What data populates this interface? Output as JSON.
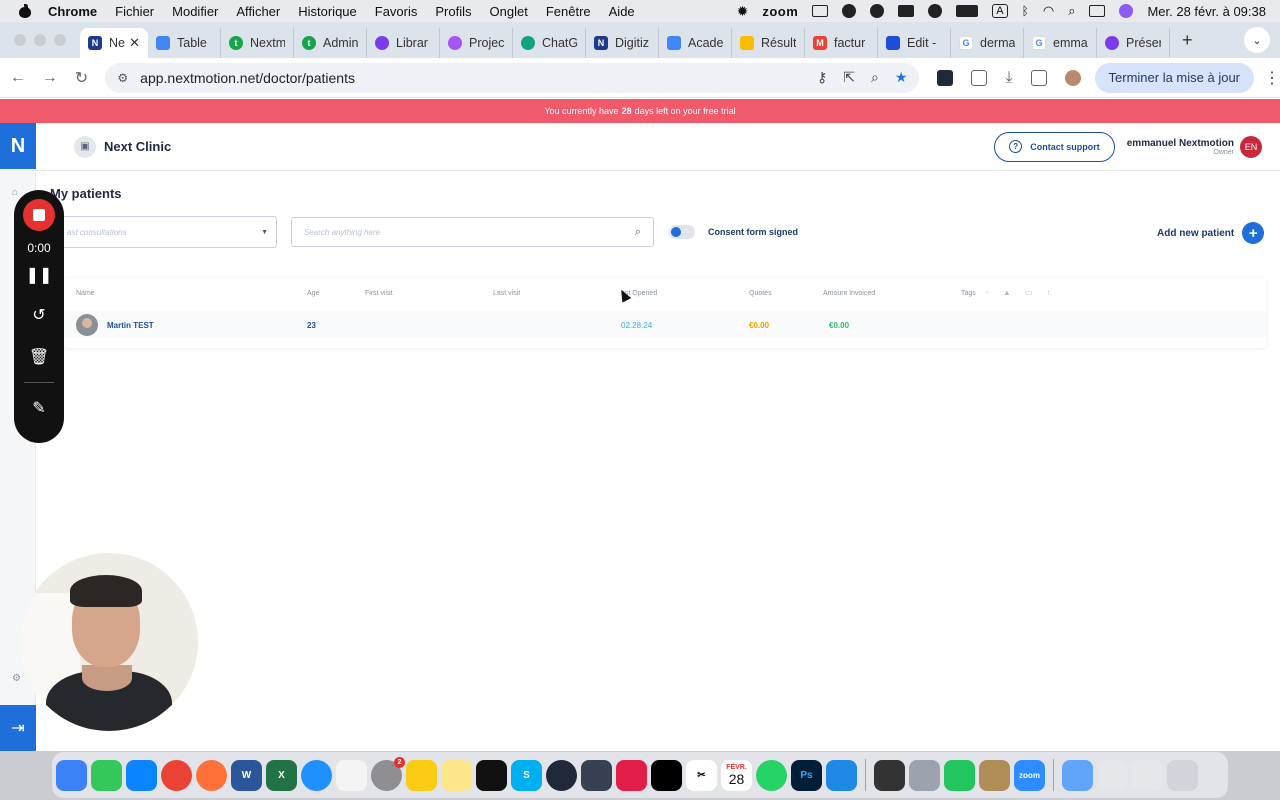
{
  "menubar": {
    "app_name": "Chrome",
    "items": [
      "Fichier",
      "Modifier",
      "Afficher",
      "Historique",
      "Favoris",
      "Profils",
      "Onglet",
      "Fenêtre",
      "Aide"
    ],
    "zoom_label": "zoom",
    "keyboard_indicator": "A",
    "clock": "Mer. 28 févr. à 09:38"
  },
  "tabs": [
    {
      "label": "Ne",
      "icon": "nextmotion-n",
      "color": "#1e3a8a",
      "active": true
    },
    {
      "label": "Table",
      "icon": "docs",
      "color": "#4285f4"
    },
    {
      "label": "Nextm",
      "icon": "t-green",
      "color": "#16a34a"
    },
    {
      "label": "Admin",
      "icon": "t-green",
      "color": "#16a34a"
    },
    {
      "label": "Librar",
      "icon": "notion-like",
      "color": "#7c3aed"
    },
    {
      "label": "Projec",
      "icon": "purple",
      "color": "#a855f7"
    },
    {
      "label": "ChatG",
      "icon": "chatgpt",
      "color": "#10a37f"
    },
    {
      "label": "Digitiz",
      "icon": "nextmotion-n",
      "color": "#1e3a8a"
    },
    {
      "label": "Acade",
      "icon": "docs",
      "color": "#4285f4"
    },
    {
      "label": "Résult",
      "icon": "drive",
      "color": "#fbbc04"
    },
    {
      "label": "factur",
      "icon": "gmail",
      "color": "#ea4335"
    },
    {
      "label": "Edit -",
      "icon": "confluence",
      "color": "#1d4ed8"
    },
    {
      "label": "derma",
      "icon": "google",
      "color": "#4285f4"
    },
    {
      "label": "emma",
      "icon": "google",
      "color": "#4285f4"
    },
    {
      "label": "Préser",
      "icon": "purple",
      "color": "#7c3aed"
    }
  ],
  "browser": {
    "url": "app.nextmotion.net/doctor/patients",
    "finish_setup_label": "Terminer la mise à jour"
  },
  "trial_banner": {
    "prefix": "You currently have",
    "days": "28",
    "suffix": "days left on your free trial"
  },
  "app": {
    "logo_letter": "N",
    "clinic_name": "Next Clinic",
    "support_label": "Contact support",
    "user_name": "emmanuel Nextmotion",
    "user_role": "Owner",
    "user_initials": "EN"
  },
  "patients_page": {
    "title": "My patients",
    "filter_placeholder": "ast consultations",
    "search_placeholder": "Search anything here",
    "consent_label": "Consent form signed",
    "consent_toggle_on": false,
    "add_label": "Add new patient",
    "columns": [
      "Name",
      "Age",
      "First visit",
      "Last visit",
      "ast Opened",
      "Quotes",
      "Amount Invoiced",
      "Tags"
    ],
    "rows": [
      {
        "name": "Martin TEST",
        "age": "23",
        "first_visit": "",
        "last_visit": "",
        "last_opened": "02.28.24",
        "quotes": "€0.00",
        "amount_invoiced": "€0.00"
      }
    ]
  },
  "recorder": {
    "time": "0:00"
  },
  "dock": {
    "calendar_month": "FÉVR.",
    "calendar_day": "28",
    "messages_badge": "2",
    "zoom_label": "zoom"
  },
  "colors": {
    "brand_blue": "#1e6fd9",
    "trial_red": "#f05a6a",
    "link_blue": "#1e4fa0",
    "quotes_orange": "#f2a100",
    "invoice_green": "#34b86a"
  }
}
